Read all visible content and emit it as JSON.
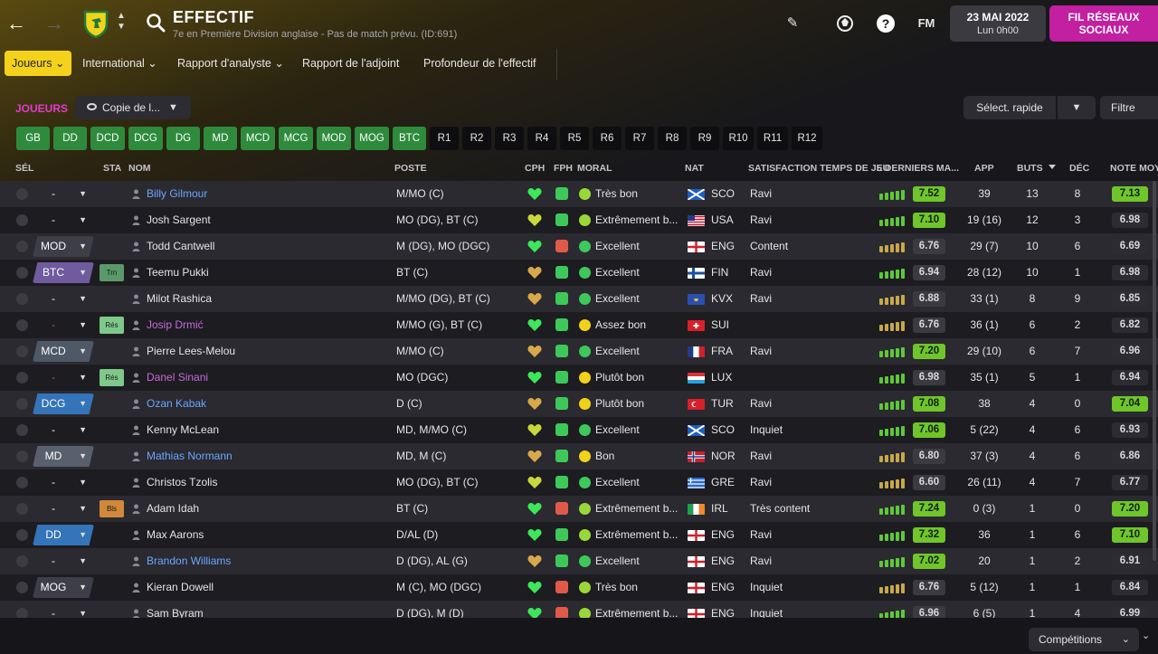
{
  "header": {
    "title": "EFFECTIF",
    "subtitle": "7e en Première Division anglaise - Pas de match prévu. (ID:691)",
    "fm_label": "FM",
    "date": "23 MAI 2022",
    "day_time": "Lun 0h00",
    "social_button": "FIL RÉSEAUX SOCIAUX",
    "back_icon": "back-arrow-icon",
    "forward_icon": "forward-arrow-icon"
  },
  "tabs": [
    {
      "label": "Joueurs",
      "active": true
    },
    {
      "label": "International"
    },
    {
      "label": "Rapport d'analyste"
    },
    {
      "label": "Rapport de l'adjoint"
    },
    {
      "label": "Profondeur de l'effectif"
    }
  ],
  "toolbar": {
    "section_label": "JOUEURS",
    "view_select": "Copie de l...",
    "quick_select": "Sélect. rapide",
    "filter": "Filtre"
  },
  "position_filters": [
    "GB",
    "DD",
    "DCD",
    "DCG",
    "DG",
    "MD",
    "MCD",
    "MCG",
    "MOD",
    "MOG",
    "BTC",
    "R1",
    "R2",
    "R3",
    "R4",
    "R5",
    "R6",
    "R7",
    "R8",
    "R9",
    "R10",
    "R11",
    "R12"
  ],
  "columns": {
    "sel": "SÉL",
    "sta": "STA",
    "nom": "NOM",
    "poste": "POSTE",
    "cph": "CPH",
    "fph": "FPH",
    "moral": "MORAL",
    "nat": "NAT",
    "satisfaction": "SATISFACTION TEMPS DE JEU",
    "last5": "5 DERNIERS MA...",
    "app": "APP",
    "buts": "BUTS",
    "dec": "DÉC",
    "note": "NOTE MOY"
  },
  "players": [
    {
      "sel": "-",
      "name": "Billy Gilmour",
      "poste": "M/MO (C)",
      "moral": "Très bon",
      "nat": "SCO",
      "sat": "Ravi",
      "rating": "7.52",
      "app": "39",
      "buts": "13",
      "dec": "8",
      "note": "7.13"
    },
    {
      "sel": "-",
      "name": "Josh Sargent",
      "poste": "MO (DG), BT (C)",
      "moral": "Extrêmement b...",
      "nat": "USA",
      "sat": "Ravi",
      "rating": "7.10",
      "app": "19 (16)",
      "buts": "12",
      "dec": "3",
      "note": "6.98"
    },
    {
      "sel": "MOD",
      "name": "Todd Cantwell",
      "poste": "M (DG), MO (DGC)",
      "moral": "Excellent",
      "nat": "ENG",
      "sat": "Content",
      "rating": "6.76",
      "app": "29 (7)",
      "buts": "10",
      "dec": "6",
      "note": "6.69"
    },
    {
      "sel": "BTC",
      "sta": "Trn",
      "name": "Teemu Pukki",
      "poste": "BT (C)",
      "moral": "Excellent",
      "nat": "FIN",
      "sat": "Ravi",
      "rating": "6.94",
      "app": "28 (12)",
      "buts": "10",
      "dec": "1",
      "note": "6.98"
    },
    {
      "sel": "-",
      "name": "Milot Rashica",
      "poste": "M/MO (DG), BT (C)",
      "moral": "Excellent",
      "nat": "KVX",
      "sat": "Ravi",
      "rating": "6.88",
      "app": "33 (1)",
      "buts": "8",
      "dec": "9",
      "note": "6.85"
    },
    {
      "sel": "-",
      "sta": "Rés",
      "name": "Josip Drmić",
      "poste": "M/MO (G), BT (C)",
      "moral": "Assez bon",
      "nat": "SUI",
      "sat": "",
      "rating": "6.76",
      "app": "36 (1)",
      "buts": "6",
      "dec": "2",
      "note": "6.82"
    },
    {
      "sel": "MCD",
      "name": "Pierre Lees-Melou",
      "poste": "M/MO (C)",
      "moral": "Excellent",
      "nat": "FRA",
      "sat": "Ravi",
      "rating": "7.20",
      "app": "29 (10)",
      "buts": "6",
      "dec": "7",
      "note": "6.96"
    },
    {
      "sel": "-",
      "sta": "Rés",
      "name": "Danel Sinani",
      "poste": "MO (DGC)",
      "moral": "Plutôt bon",
      "nat": "LUX",
      "sat": "",
      "rating": "6.98",
      "app": "35 (1)",
      "buts": "5",
      "dec": "1",
      "note": "6.94"
    },
    {
      "sel": "DCG",
      "name": "Ozan Kabak",
      "poste": "D (C)",
      "moral": "Plutôt bon",
      "nat": "TUR",
      "sat": "Ravi",
      "rating": "7.08",
      "app": "38",
      "buts": "4",
      "dec": "0",
      "note": "7.04"
    },
    {
      "sel": "-",
      "name": "Kenny McLean",
      "poste": "MD, M/MO (C)",
      "moral": "Excellent",
      "nat": "SCO",
      "sat": "Inquiet",
      "rating": "7.06",
      "app": "5 (22)",
      "buts": "4",
      "dec": "6",
      "note": "6.93"
    },
    {
      "sel": "MD",
      "name": "Mathias Normann",
      "poste": "MD, M (C)",
      "moral": "Bon",
      "nat": "NOR",
      "sat": "Ravi",
      "rating": "6.80",
      "app": "37 (3)",
      "buts": "4",
      "dec": "6",
      "note": "6.86"
    },
    {
      "sel": "-",
      "name": "Christos Tzolis",
      "poste": "MO (DG), BT (C)",
      "moral": "Excellent",
      "nat": "GRE",
      "sat": "Ravi",
      "rating": "6.60",
      "app": "26 (11)",
      "buts": "4",
      "dec": "7",
      "note": "6.77"
    },
    {
      "sel": "-",
      "sta": "Bls",
      "name": "Adam Idah",
      "poste": "BT (C)",
      "moral": "Extrêmement b...",
      "nat": "IRL",
      "sat": "Très content",
      "rating": "7.24",
      "app": "0 (3)",
      "buts": "1",
      "dec": "0",
      "note": "7.20"
    },
    {
      "sel": "DD",
      "name": "Max Aarons",
      "poste": "D/AL (D)",
      "moral": "Extrêmement b...",
      "nat": "ENG",
      "sat": "Ravi",
      "rating": "7.32",
      "app": "36",
      "buts": "1",
      "dec": "6",
      "note": "7.10"
    },
    {
      "sel": "-",
      "name": "Brandon Williams",
      "poste": "D (DG), AL (G)",
      "moral": "Excellent",
      "nat": "ENG",
      "sat": "Ravi",
      "rating": "7.02",
      "app": "20",
      "buts": "1",
      "dec": "2",
      "note": "6.91"
    },
    {
      "sel": "MOG",
      "name": "Kieran Dowell",
      "poste": "M (C), MO (DGC)",
      "moral": "Très bon",
      "nat": "ENG",
      "sat": "Inquiet",
      "rating": "6.76",
      "app": "5 (12)",
      "buts": "1",
      "dec": "1",
      "note": "6.84"
    },
    {
      "sel": "-",
      "name": "Sam Byram",
      "poste": "D (DG), M (D)",
      "moral": "Extrêmement b...",
      "nat": "ENG",
      "sat": "Inquiet",
      "rating": "6.96",
      "app": "6 (5)",
      "buts": "1",
      "dec": "4",
      "note": "6.99"
    }
  ],
  "footer": {
    "competitions": "Compétitions"
  },
  "colors": {
    "accent_yellow": "#f4d21b",
    "social_magenta": "#c21fa1",
    "position_green": "#2e8b3c",
    "rating_green": "#7ed321"
  }
}
